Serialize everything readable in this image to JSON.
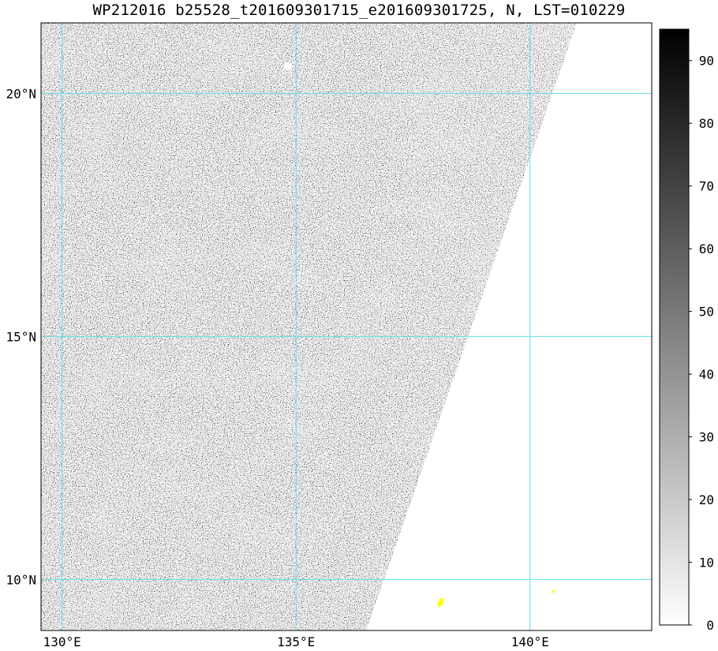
{
  "title": "WP212016 b25528_t201609301715_e201609301725, N, LST=010229",
  "map": {
    "lon_range": [
      129.55,
      142.6
    ],
    "lat_range": [
      8.95,
      21.45
    ],
    "lon_ticks": [
      130,
      135,
      140
    ],
    "lat_ticks": [
      10,
      15,
      20
    ],
    "lon_tick_labels": [
      "130°E",
      "135°E",
      "140°E"
    ],
    "lat_tick_labels": [
      "10°N",
      "15°N",
      "20°N"
    ],
    "gridline_color": "#5ce1e6",
    "no_data_color": "#ffffff",
    "land_color": "#ffff00",
    "swath_edge": [
      {
        "lon": 141.0,
        "lat": 21.45
      },
      {
        "lon": 136.5,
        "lat": 8.95
      }
    ],
    "land_features": [
      {
        "name": "small-island-1",
        "lon": 138.1,
        "lat": 9.55
      },
      {
        "name": "small-island-2",
        "lon": 140.5,
        "lat": 9.75
      }
    ]
  },
  "colorbar": {
    "min": 0,
    "max": 95,
    "ticks": [
      0,
      10,
      20,
      30,
      40,
      50,
      60,
      70,
      80,
      90
    ],
    "tick_labels": [
      "0",
      "10",
      "20",
      "30",
      "40",
      "50",
      "60",
      "70",
      "80",
      "90"
    ],
    "low_color": "#ffffff",
    "high_color": "#000000"
  }
}
